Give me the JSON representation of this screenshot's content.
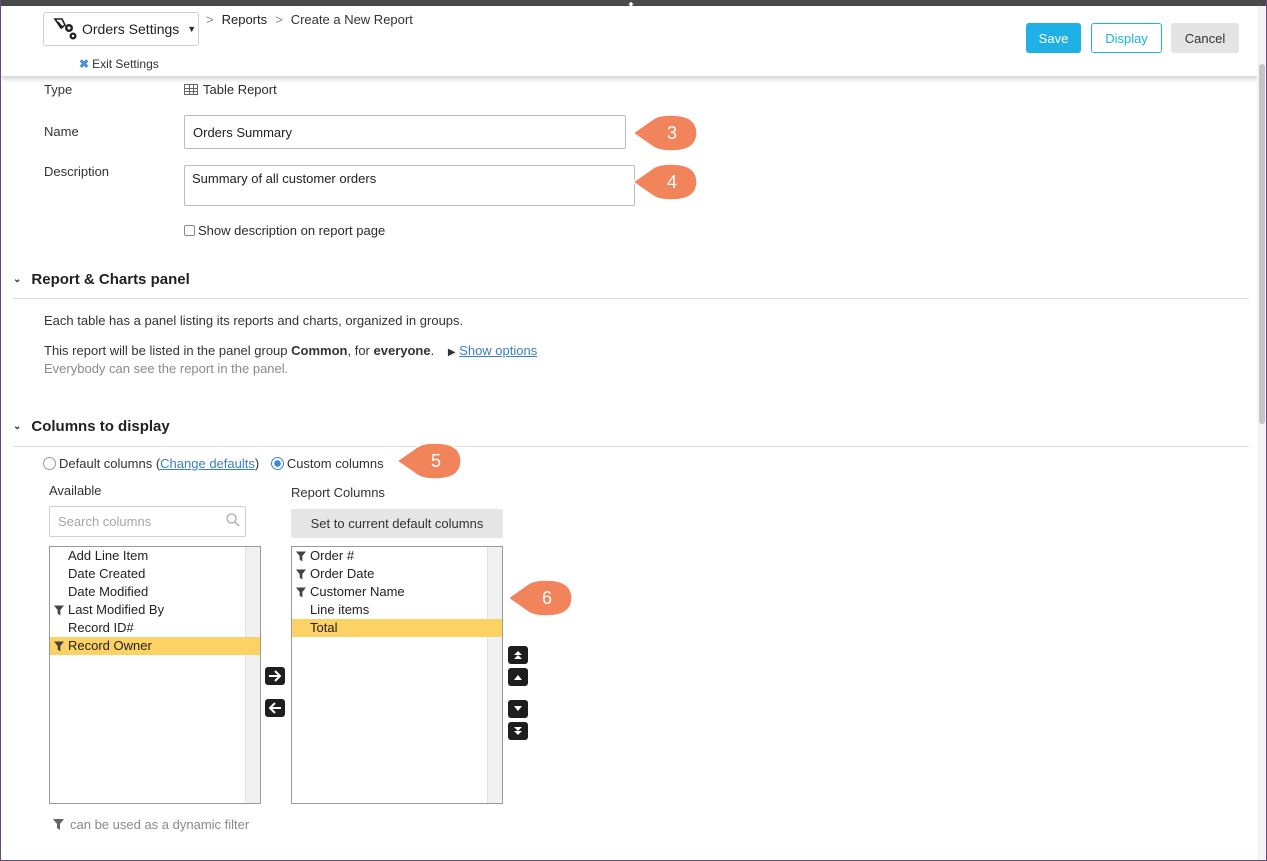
{
  "header": {
    "settings_label": "Orders Settings",
    "exit_label": "Exit Settings",
    "breadcrumbs": [
      "Reports",
      "Create a New Report"
    ],
    "buttons": {
      "save": "Save",
      "display": "Display",
      "cancel": "Cancel"
    }
  },
  "form": {
    "type_label": "Type",
    "type_value": "Table Report",
    "name_label": "Name",
    "name_value": "Orders Summary",
    "description_label": "Description",
    "description_value": "Summary of all customer orders",
    "show_description_label": "Show description on report page",
    "show_description_checked": false
  },
  "panel_section": {
    "title": "Report & Charts panel",
    "intro": "Each table has a panel listing its reports and charts, organized in groups.",
    "listing_prefix": "This report will be listed in the panel group ",
    "group": "Common",
    "listing_mid": ", for ",
    "audience": "everyone",
    "listing_suffix": ".",
    "show_options": "Show options",
    "note": "Everybody can see the report in the panel."
  },
  "columns_section": {
    "title": "Columns to display",
    "default_label": "Default columns",
    "change_defaults": "Change defaults",
    "custom_label": "Custom columns",
    "selected_mode": "custom",
    "available_title": "Available",
    "report_title": "Report Columns",
    "search_placeholder": "Search columns",
    "set_default_button": "Set to current default columns",
    "available": [
      {
        "label": "Add Line Item",
        "filter": false,
        "selected": false
      },
      {
        "label": "Date Created",
        "filter": false,
        "selected": false
      },
      {
        "label": "Date Modified",
        "filter": false,
        "selected": false
      },
      {
        "label": "Last Modified By",
        "filter": true,
        "selected": false
      },
      {
        "label": "Record ID#",
        "filter": false,
        "selected": false
      },
      {
        "label": "Record Owner",
        "filter": true,
        "selected": true
      }
    ],
    "report_columns": [
      {
        "label": "Order #",
        "filter": true,
        "selected": false
      },
      {
        "label": "Order Date",
        "filter": true,
        "selected": false
      },
      {
        "label": "Customer Name",
        "filter": true,
        "selected": false
      },
      {
        "label": "Line items",
        "filter": false,
        "selected": false
      },
      {
        "label": "Total",
        "filter": false,
        "selected": true
      }
    ],
    "footnote": "can be used as a dynamic filter"
  },
  "callouts": [
    "3",
    "4",
    "5",
    "6"
  ],
  "colors": {
    "accent": "#1fb1e6",
    "highlight": "#fdd264",
    "callout": "#f2845c",
    "link": "#3b7fc4"
  },
  "icons": {
    "settings": "settings-gear-icon",
    "exit": "close-icon",
    "type": "table-grid-icon",
    "search": "search-icon",
    "filter": "funnel-icon"
  }
}
